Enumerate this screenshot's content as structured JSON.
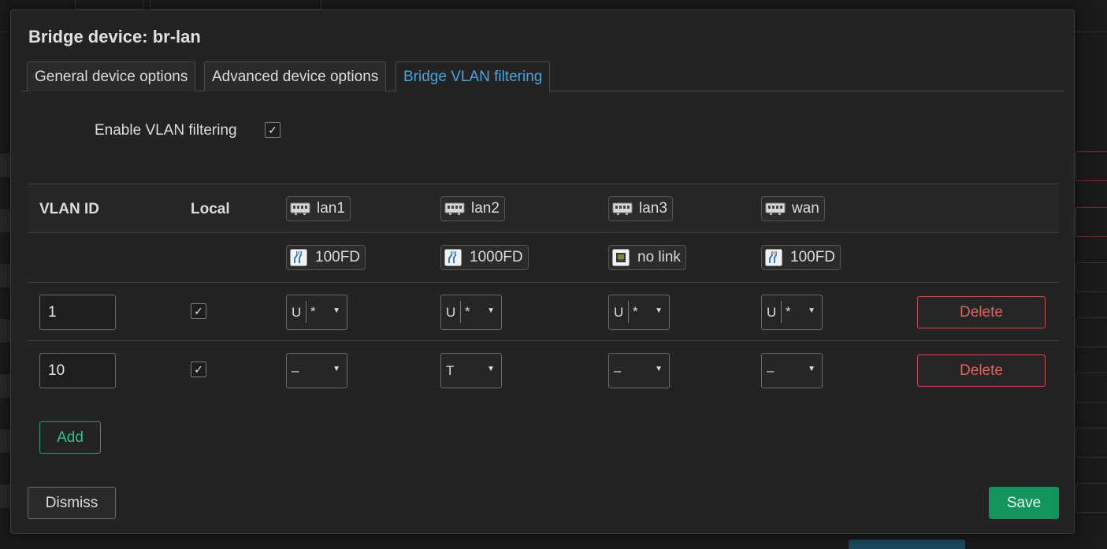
{
  "modal": {
    "title": "Bridge device: br-lan",
    "tabs": [
      {
        "label": "General device options",
        "active": false
      },
      {
        "label": "Advanced device options",
        "active": false
      },
      {
        "label": "Bridge VLAN filtering",
        "active": true
      }
    ],
    "enable_vlan_filtering": {
      "label": "Enable VLAN filtering",
      "checked": true,
      "mark": "✓"
    }
  },
  "table": {
    "headers": {
      "vlan_id": "VLAN ID",
      "local": "Local"
    },
    "ports": [
      {
        "name": "lan1",
        "link": "100FD",
        "link_icon": "ethernet-connected-icon"
      },
      {
        "name": "lan2",
        "link": "1000FD",
        "link_icon": "ethernet-connected-icon"
      },
      {
        "name": "lan3",
        "link": "no link",
        "link_icon": "ethernet-disconnected-icon"
      },
      {
        "name": "wan",
        "link": "100FD",
        "link_icon": "ethernet-connected-icon"
      }
    ],
    "rows": [
      {
        "vlan_id": "1",
        "local": true,
        "local_mark": "✓",
        "ports": [
          {
            "mode": "U",
            "flag": "*"
          },
          {
            "mode": "U",
            "flag": "*"
          },
          {
            "mode": "U",
            "flag": "*"
          },
          {
            "mode": "U",
            "flag": "*"
          }
        ],
        "delete_label": "Delete"
      },
      {
        "vlan_id": "10",
        "local": true,
        "local_mark": "✓",
        "ports": [
          {
            "mode": "–",
            "flag": ""
          },
          {
            "mode": "T",
            "flag": ""
          },
          {
            "mode": "–",
            "flag": ""
          },
          {
            "mode": "–",
            "flag": ""
          }
        ],
        "delete_label": "Delete"
      }
    ],
    "select_arrow": "▼"
  },
  "buttons": {
    "add": "Add",
    "dismiss": "Dismiss",
    "save": "Save"
  },
  "colors": {
    "accent": "#4aa3df",
    "danger": "#e0605c",
    "success": "#13935e"
  }
}
